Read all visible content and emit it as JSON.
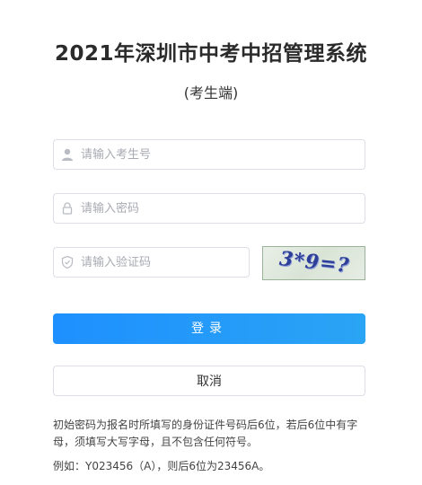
{
  "header": {
    "title": "2021年深圳市中考中招管理系统",
    "subtitle": "(考生端)"
  },
  "form": {
    "username": {
      "placeholder": "请输入考生号",
      "value": "",
      "icon": "user-icon"
    },
    "password": {
      "placeholder": "请输入密码",
      "value": "",
      "icon": "lock-icon"
    },
    "captcha": {
      "placeholder": "请输入验证码",
      "value": "",
      "icon": "shield-icon",
      "image_text": "3*9=?"
    },
    "login_label": "登录",
    "cancel_label": "取消"
  },
  "notes": {
    "rule": "初始密码为报名时所填写的身份证件号码后6位，若后6位中有字母，须填写大写字母，且不包含任何符号。",
    "example": "例如：Y023456（A），则后6位为23456A。"
  },
  "colors": {
    "primary": "#1e90ff",
    "border": "#dcdfe6",
    "placeholder": "#a8abb2"
  }
}
